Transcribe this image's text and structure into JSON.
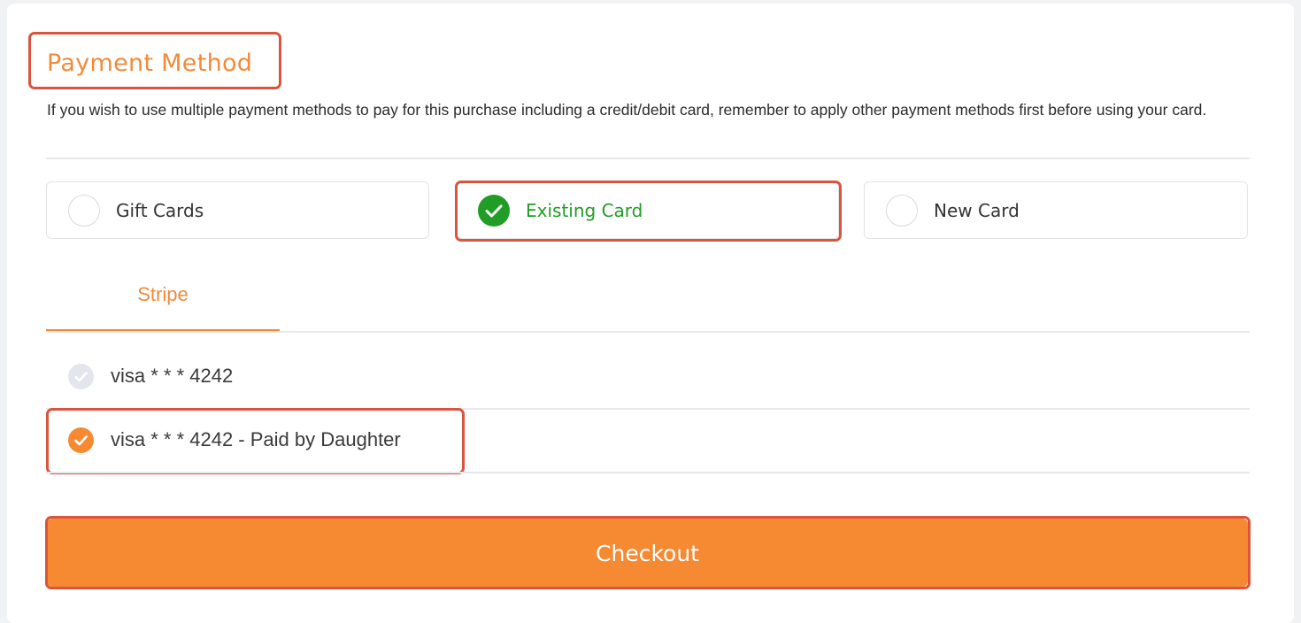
{
  "header": {
    "title": "Payment Method",
    "description": "If you wish to use multiple payment methods to pay for this purchase including a credit/debit card, remember to apply other payment methods first before using your card."
  },
  "options": [
    {
      "label": "Gift Cards",
      "selected": false
    },
    {
      "label": "Existing Card",
      "selected": true
    },
    {
      "label": "New Card",
      "selected": false
    }
  ],
  "tabs": [
    {
      "label": "Stripe",
      "active": true
    }
  ],
  "cards": [
    {
      "label": "visa * * * 4242",
      "selected": false
    },
    {
      "label": "visa * * * 4242 - Paid by Daughter",
      "selected": true
    }
  ],
  "checkout": {
    "label": "Checkout"
  },
  "colors": {
    "accent": "#f28a3a",
    "button": "#f58a33",
    "success": "#1f9d25",
    "highlight": "#d9553e"
  }
}
